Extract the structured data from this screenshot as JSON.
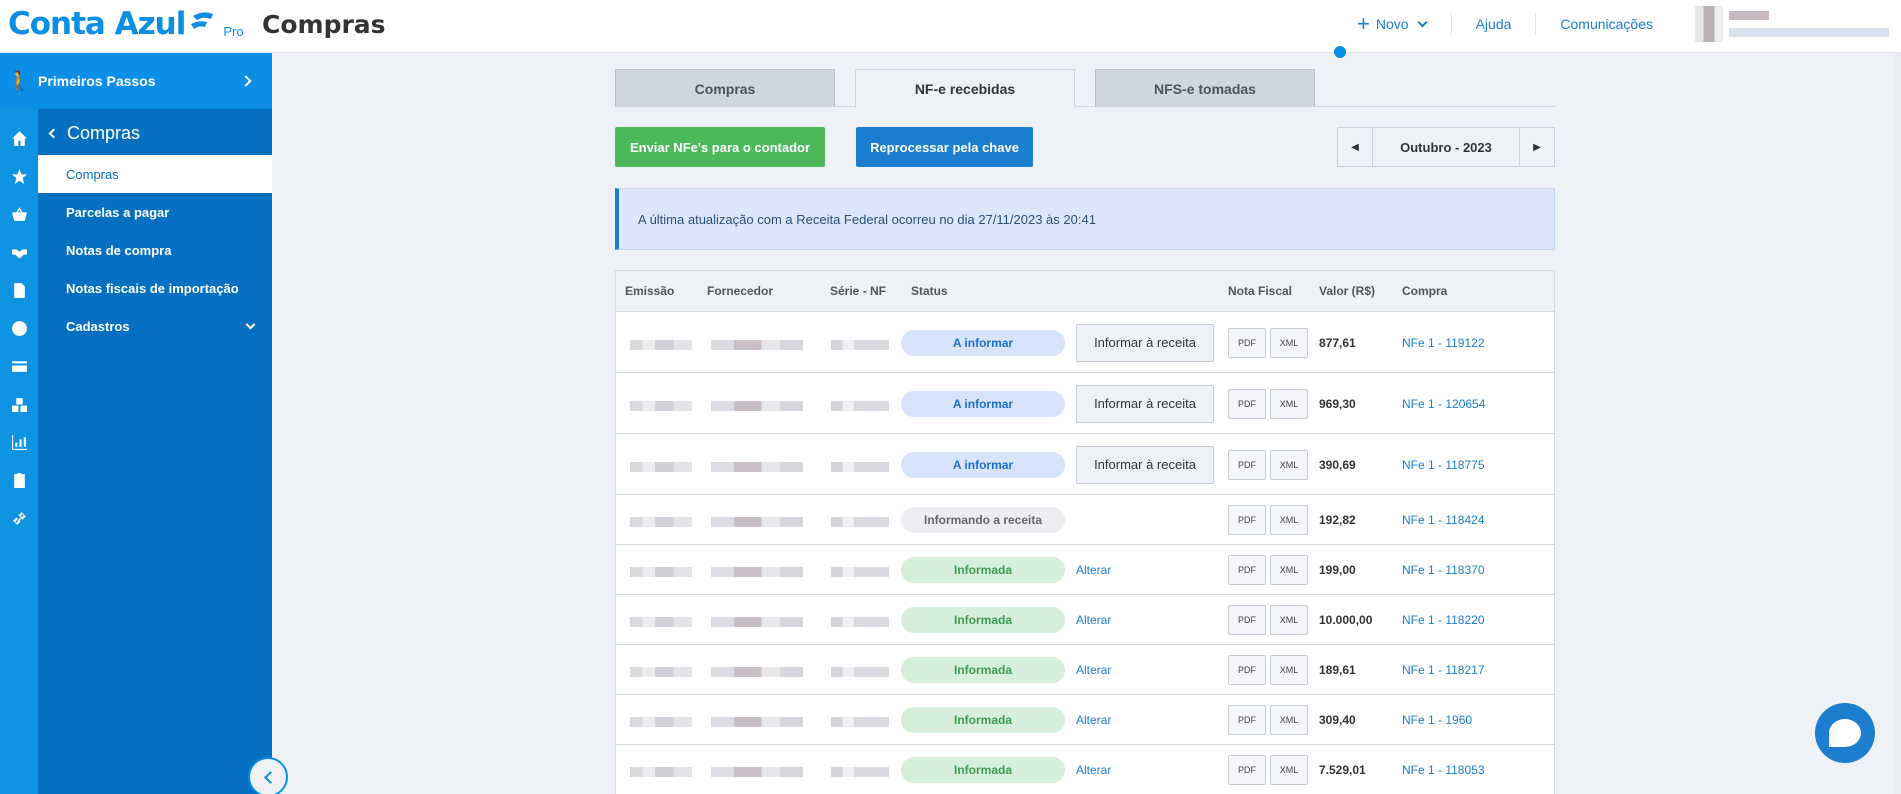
{
  "header": {
    "brand": "Conta Azul",
    "brand_suffix": "Pro",
    "page_title": "Compras",
    "novo_label": "Novo",
    "links": [
      "Ajuda",
      "Comunicações"
    ]
  },
  "sidebar": {
    "primeiros_passos": "Primeiros Passos",
    "section_title": "Compras",
    "items": [
      {
        "label": "Compras"
      },
      {
        "label": "Parcelas a pagar"
      },
      {
        "label": "Notas de compra"
      },
      {
        "label": "Notas fiscais de importação"
      },
      {
        "label": "Cadastros"
      }
    ],
    "rail_icons": [
      "home-icon",
      "star-icon",
      "basket-icon",
      "handshake-icon",
      "document-icon",
      "dollar-icon",
      "card-icon",
      "boxes-icon",
      "chart-icon",
      "clipboard-icon",
      "link-icon"
    ]
  },
  "tabs": [
    "Compras",
    "NF-e recebidas",
    "NFS-e tomadas"
  ],
  "actions": {
    "send_button": "Enviar NFe's para o contador",
    "reprocess_button": "Reprocessar pela chave",
    "month": "Outubro - 2023"
  },
  "notice": "A última atualização com a Receita Federal ocorreu no dia 27/11/2023 às 20:41",
  "table": {
    "columns": [
      "Emissão",
      "Fornecedor",
      "Série - NF",
      "Status",
      "Nota Fiscal",
      "Valor (R$)",
      "Compra"
    ],
    "doc_labels": {
      "pdf": "PDF",
      "xml": "XML"
    },
    "inform_button": "Informar à receita",
    "alter_link": "Alterar",
    "rows": [
      {
        "status": "A informar",
        "status_kind": "blue",
        "action": "button",
        "valor": "877,61",
        "compra": "NFe 1 - 119122"
      },
      {
        "status": "A informar",
        "status_kind": "blue",
        "action": "button",
        "valor": "969,30",
        "compra": "NFe 1 - 120654"
      },
      {
        "status": "A informar",
        "status_kind": "blue",
        "action": "button",
        "valor": "390,69",
        "compra": "NFe 1 - 118775"
      },
      {
        "status": "Informando a receita",
        "status_kind": "gray",
        "action": "none",
        "valor": "192,82",
        "compra": "NFe 1 - 118424"
      },
      {
        "status": "Informada",
        "status_kind": "green",
        "action": "link",
        "valor": "199,00",
        "compra": "NFe 1 - 118370"
      },
      {
        "status": "Informada",
        "status_kind": "green",
        "action": "link",
        "valor": "10.000,00",
        "compra": "NFe 1 - 118220"
      },
      {
        "status": "Informada",
        "status_kind": "green",
        "action": "link",
        "valor": "189,61",
        "compra": "NFe 1 - 118217"
      },
      {
        "status": "Informada",
        "status_kind": "green",
        "action": "link",
        "valor": "309,40",
        "compra": "NFe 1 - 1960"
      },
      {
        "status": "Informada",
        "status_kind": "green",
        "action": "link",
        "valor": "7.529,01",
        "compra": "NFe 1 - 118053"
      }
    ]
  },
  "colors": {
    "brand": "#0a8ee6",
    "sidebar": "#0570c2",
    "green": "#4cb85c",
    "link": "#1b7ecf"
  }
}
